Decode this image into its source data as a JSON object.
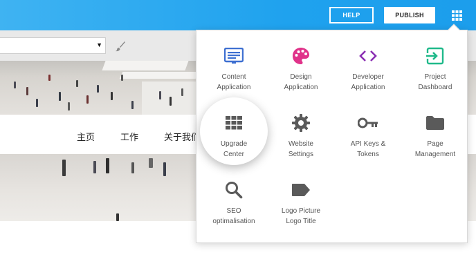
{
  "topbar": {
    "help_label": "HELP",
    "publish_label": "PUBLISH",
    "apps_icon": "apps-grid-icon",
    "color": "#1fa2ee"
  },
  "editor": {
    "select_value": "",
    "select_arrow": "▼",
    "brush_icon": "brush-icon"
  },
  "nav": {
    "items": [
      "主页",
      "工作",
      "关于我们"
    ]
  },
  "menu": {
    "tiles": [
      {
        "label": "Content\nApplication",
        "icon": "content-application-icon",
        "color": "#3d6fd1"
      },
      {
        "label": "Design\nApplication",
        "icon": "palette-icon",
        "color": "#e0338a"
      },
      {
        "label": "Developer\nApplication",
        "icon": "code-icon",
        "color": "#8b2fb3"
      },
      {
        "label": "Project\nDashboard",
        "icon": "exit-dashboard-icon",
        "color": "#1fb98a"
      },
      {
        "label": "Upgrade\nCenter",
        "icon": "grid-icon",
        "color": "#5a5a5a"
      },
      {
        "label": "Website\nSettings",
        "icon": "gear-icon",
        "color": "#5a5a5a"
      },
      {
        "label": "API Keys &\nTokens",
        "icon": "key-icon",
        "color": "#5a5a5a"
      },
      {
        "label": "Page\nManagement",
        "icon": "folder-icon",
        "color": "#5a5a5a"
      },
      {
        "label": "SEO\noptimalisation",
        "icon": "search-icon",
        "color": "#5a5a5a"
      },
      {
        "label": "Logo Picture\nLogo Title",
        "icon": "label-tag-icon",
        "color": "#5a5a5a"
      }
    ]
  }
}
